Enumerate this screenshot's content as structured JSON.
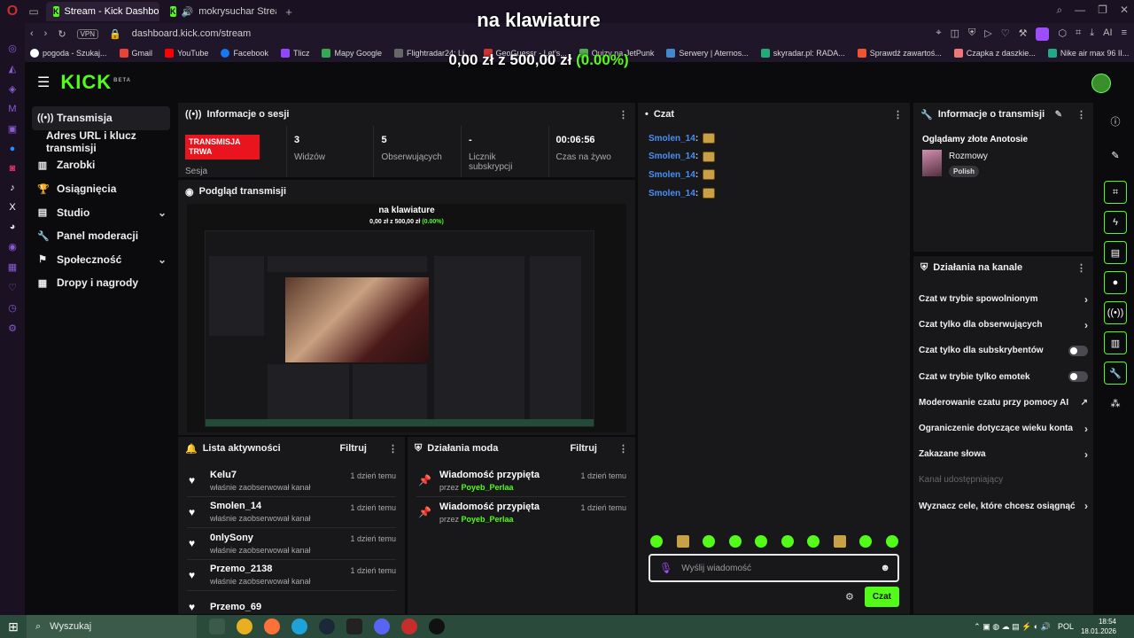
{
  "browser": {
    "tabs": [
      {
        "label": "Stream - Kick Dashboard",
        "active": true
      },
      {
        "label": "mokrysuchar Stream -",
        "active": false
      }
    ],
    "vpn_label": "VPN",
    "url": "dashboard.kick.com/stream",
    "ai_label": "AI",
    "bookmarks": [
      "pogoda - Szukaj...",
      "Gmail",
      "YouTube",
      "Facebook",
      "Tlicz",
      "Mapy Google",
      "Flightradar24: Li...",
      "GeoGuessr - Let's...",
      "Quizy na JetPunk",
      "Serwery | Aternos...",
      "skyradar.pl: RADA...",
      "Sprawdź zawartoś...",
      "Czapka z daszkie...",
      "Nike air max 96 II..."
    ]
  },
  "overlay": {
    "title": "na klawiature",
    "goal_current": "0,00 zł",
    "goal_sep": "z",
    "goal_total": "500,00 zł",
    "goal_pct": "(0.00%)"
  },
  "header": {
    "logo": "KICK",
    "logo_badge": "BETA"
  },
  "nav": [
    {
      "label": "Transmisja",
      "icon": "((•))",
      "active": true
    },
    {
      "label": "Adres URL i klucz transmisji",
      "sub": true
    },
    {
      "label": "Zarobki",
      "icon": "▥"
    },
    {
      "label": "Osiągnięcia",
      "icon": "🏆"
    },
    {
      "label": "Studio",
      "icon": "▤",
      "chevron": "⌄"
    },
    {
      "label": "Panel moderacji",
      "icon": "🔧"
    },
    {
      "label": "Społeczność",
      "icon": "⚑",
      "chevron": "⌄"
    },
    {
      "label": "Dropy i nagrody",
      "icon": "▦"
    }
  ],
  "session": {
    "title": "Informacje o sesji",
    "live_badge": "TRANSMISJA TRWA",
    "live_label": "Sesja",
    "stats": [
      {
        "value": "3",
        "label": "Widzów"
      },
      {
        "value": "5",
        "label": "Obserwujących"
      },
      {
        "value": "-",
        "label": "Licznik subskrypcji"
      },
      {
        "value": "00:06:56",
        "label": "Czas na żywo"
      }
    ]
  },
  "preview": {
    "title": "Podgląd transmisji"
  },
  "activity": {
    "title": "Lista aktywności",
    "filter": "Filtruj",
    "items": [
      {
        "name": "Kelu7",
        "desc": "właśnie zaobserwował kanał",
        "time": "1 dzień temu"
      },
      {
        "name": "Smolen_14",
        "desc": "właśnie zaobserwował kanał",
        "time": "1 dzień temu"
      },
      {
        "name": "0nlySony",
        "desc": "właśnie zaobserwował kanał",
        "time": "1 dzień temu"
      },
      {
        "name": "Przemo_2138",
        "desc": "właśnie zaobserwował kanał",
        "time": "1 dzień temu"
      },
      {
        "name": "Przemo_69",
        "desc": "",
        "time": ""
      }
    ]
  },
  "mod": {
    "title": "Działania moda",
    "filter": "Filtruj",
    "items": [
      {
        "name": "Wiadomość przypięta",
        "by": "przez",
        "user": "Poyeb_Perlaa",
        "time": "1 dzień temu"
      },
      {
        "name": "Wiadomość przypięta",
        "by": "przez",
        "user": "Poyeb_Perlaa",
        "time": "1 dzień temu"
      }
    ]
  },
  "chat": {
    "title": "Czat",
    "messages": [
      "Smolen_14",
      "Smolen_14",
      "Smolen_14",
      "Smolen_14"
    ],
    "placeholder": "Wyślij wiadomość",
    "send": "Czat"
  },
  "stream_info": {
    "title": "Informacje o transmisji",
    "stream_title": "Oglądamy złote Anotosie",
    "category": "Rozmowy",
    "tag": "Polish"
  },
  "channel_actions": {
    "title": "Działania na kanale",
    "items": [
      {
        "label": "Czat w trybie spowolnionym",
        "control": "chevron"
      },
      {
        "label": "Czat tylko dla obserwujących",
        "control": "chevron"
      },
      {
        "label": "Czat tylko dla subskrybentów",
        "control": "toggle"
      },
      {
        "label": "Czat w trybie tylko emotek",
        "control": "toggle"
      },
      {
        "label": "Moderowanie czatu przy pomocy AI",
        "control": "external"
      },
      {
        "label": "Ograniczenie dotyczące wieku konta",
        "control": "chevron"
      },
      {
        "label": "Zakazane słowa",
        "control": "chevron"
      },
      {
        "label": "Kanał udostępniający",
        "control": "none",
        "disabled": true
      },
      {
        "label": "Wyznacz cele, które chcesz osiągnąć",
        "control": "chevron"
      }
    ]
  },
  "taskbar": {
    "search": "Wyszukaj",
    "lang": "POL",
    "time": "18:54",
    "date": "18.01.2026"
  }
}
